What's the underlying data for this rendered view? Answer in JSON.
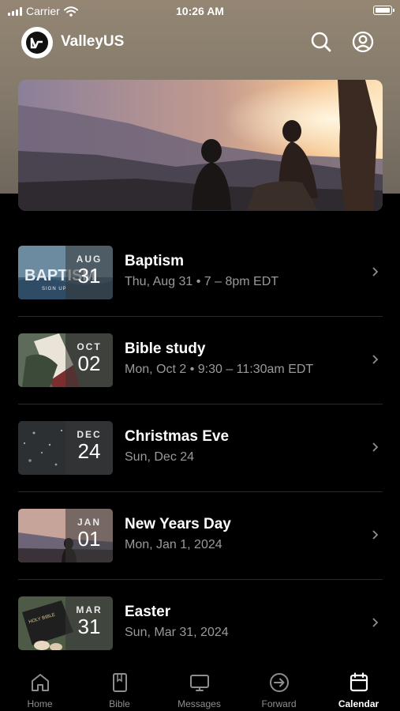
{
  "status_bar": {
    "carrier": "Carrier",
    "time": "10:26 AM"
  },
  "header": {
    "app_name": "ValleyUS"
  },
  "events": [
    {
      "title": "Baptism",
      "month": "AUG",
      "day": "31",
      "details": "Thu, Aug 31 • 7 – 8pm EDT",
      "thumb_text": "BAPTISM",
      "thumb_subtext": "SIGN UP"
    },
    {
      "title": "Bible study",
      "month": "OCT",
      "day": "02",
      "details": "Mon, Oct 2 • 9:30 – 11:30am EDT"
    },
    {
      "title": "Christmas Eve",
      "month": "DEC",
      "day": "24",
      "details": "Sun, Dec 24"
    },
    {
      "title": "New Years Day",
      "month": "JAN",
      "day": "01",
      "details": "Mon, Jan 1, 2024"
    },
    {
      "title": "Easter",
      "month": "MAR",
      "day": "31",
      "details": "Sun, Mar 31, 2024",
      "thumb_text": "HOLY BIBLE"
    }
  ],
  "tabs": [
    {
      "label": "Home",
      "icon": "home-icon"
    },
    {
      "label": "Bible",
      "icon": "bible-icon"
    },
    {
      "label": "Messages",
      "icon": "messages-icon"
    },
    {
      "label": "Forward",
      "icon": "forward-icon"
    },
    {
      "label": "Calendar",
      "icon": "calendar-icon",
      "active": true
    }
  ]
}
